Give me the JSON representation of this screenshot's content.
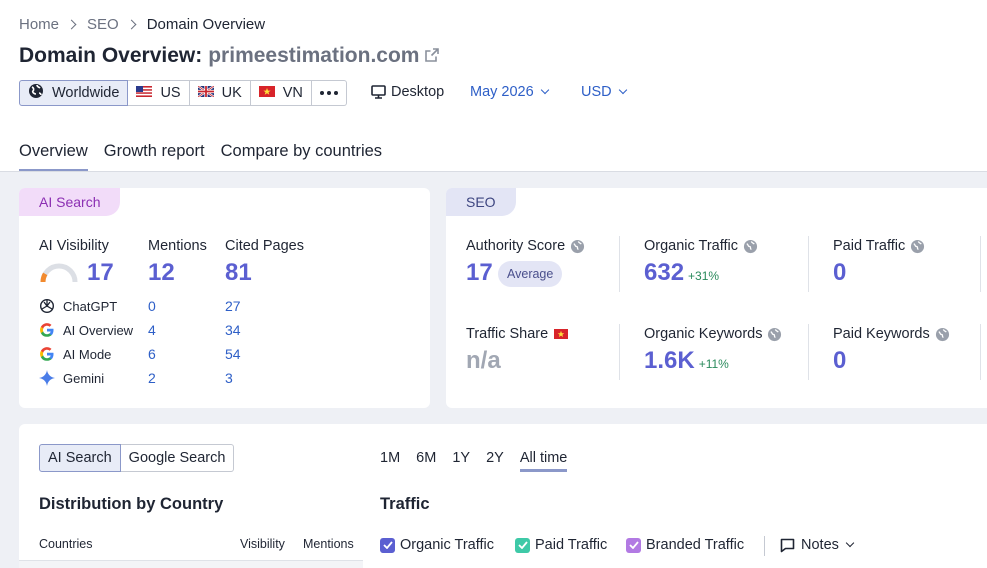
{
  "breadcrumb": [
    "Home",
    "SEO",
    "Domain Overview"
  ],
  "title": {
    "prefix": "Domain Overview:",
    "domain": "primeestimation.com"
  },
  "databases": [
    {
      "label": "Worldwide",
      "active": true
    },
    {
      "label": "US",
      "active": false
    },
    {
      "label": "UK",
      "active": false
    },
    {
      "label": "VN",
      "active": false
    }
  ],
  "device": "Desktop",
  "date": "May 2026",
  "currency": "USD",
  "tabs": [
    "Overview",
    "Growth report",
    "Compare by countries"
  ],
  "ai_card": {
    "tag": "AI Search",
    "headers": {
      "visibility": "AI Visibility",
      "mentions": "Mentions",
      "cited": "Cited Pages"
    },
    "visibility_value": "17",
    "visibility_fraction": 0.17,
    "mentions_value": "12",
    "cited_value": "81",
    "rows": [
      {
        "name": "ChatGPT",
        "mentions": "0",
        "cited": "27"
      },
      {
        "name": "AI Overview",
        "mentions": "4",
        "cited": "34"
      },
      {
        "name": "AI Mode",
        "mentions": "6",
        "cited": "54"
      },
      {
        "name": "Gemini",
        "mentions": "2",
        "cited": "3"
      }
    ]
  },
  "seo_card": {
    "tag": "SEO",
    "authority": {
      "label": "Authority Score",
      "value": "17",
      "badge": "Average"
    },
    "organic_traffic": {
      "label": "Organic Traffic",
      "value": "632",
      "change": "+31%"
    },
    "paid_traffic": {
      "label": "Paid Traffic",
      "value": "0"
    },
    "traffic_share": {
      "label": "Traffic Share",
      "value": "n/a"
    },
    "organic_keywords": {
      "label": "Organic Keywords",
      "value": "1.6K",
      "change": "+11%"
    },
    "paid_keywords": {
      "label": "Paid Keywords",
      "value": "0"
    }
  },
  "bottom": {
    "segment": [
      "AI Search",
      "Google Search"
    ],
    "periods": [
      "1M",
      "6M",
      "1Y",
      "2Y",
      "All time"
    ],
    "distribution_title": "Distribution by Country",
    "columns": [
      "Countries",
      "Visibility",
      "Mentions"
    ],
    "traffic_title": "Traffic",
    "legend": [
      "Organic Traffic",
      "Paid Traffic",
      "Branded Traffic"
    ],
    "notes": "Notes"
  },
  "colors": {
    "accent": "#5b5fd1",
    "link": "#2e5fc7",
    "ai_tag": "#f2dcf9",
    "seo_tag": "#e3e5f5",
    "organic": "#5b5fd1",
    "paid": "#3ec9a7",
    "branded": "#b27ae3"
  }
}
